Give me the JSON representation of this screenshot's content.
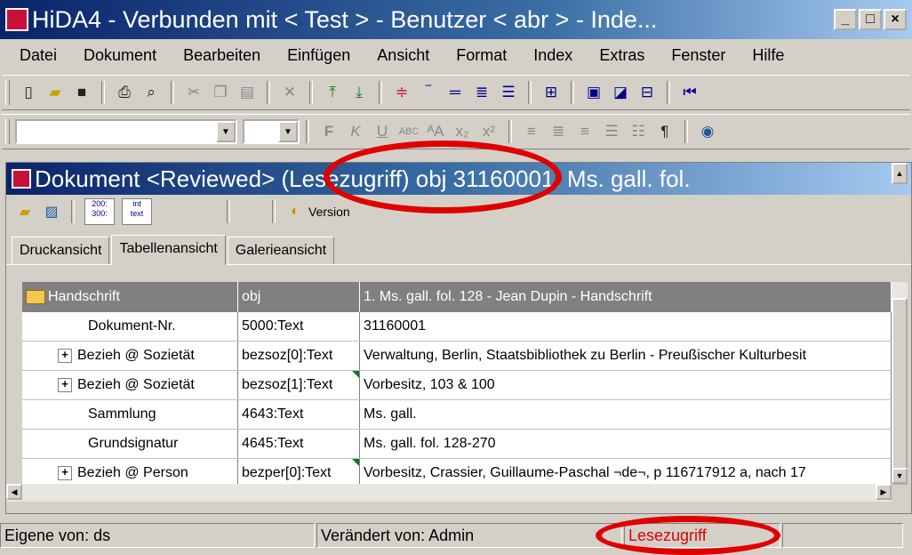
{
  "window": {
    "title": "HiDA4 - Verbunden mit < Test > - Benutzer < abr > - Inde...",
    "controls": [
      "_",
      "□",
      "×"
    ]
  },
  "menu": [
    "Datei",
    "Dokument",
    "Bearbeiten",
    "Einfügen",
    "Ansicht",
    "Format",
    "Index",
    "Extras",
    "Fenster",
    "Hilfe"
  ],
  "document": {
    "title": "Dokument <Reviewed> (Lesezugriff) obj 31160001: Ms. gall. fol.",
    "version_button": "Version",
    "numbers_button": [
      "200:",
      "300:"
    ],
    "inttext_button": [
      "int",
      "text"
    ]
  },
  "tabs": [
    "Druckansicht",
    "Tabellenansicht",
    "Galerieansicht"
  ],
  "active_tab": "Tabellenansicht",
  "table": {
    "header": [
      "Handschrift",
      "obj",
      "1. Ms. gall. fol. 128 - Jean Dupin - Handschrift"
    ],
    "rows": [
      {
        "label": "Dokument-Nr.",
        "field": "5000:Text",
        "value": "31160001",
        "expandable": false,
        "marker": false
      },
      {
        "label": "Bezieh @ Sozietät",
        "field": "bezsoz[0]:Text",
        "value": "Verwaltung, Berlin, Staatsbibliothek zu Berlin - Preußischer Kulturbesit",
        "expandable": true,
        "marker": false
      },
      {
        "label": "Bezieh @ Sozietät",
        "field": "bezsoz[1]:Text",
        "value": "Vorbesitz, 103 & 100",
        "expandable": true,
        "marker": true
      },
      {
        "label": "Sammlung",
        "field": "4643:Text",
        "value": "Ms. gall.",
        "expandable": false,
        "marker": false
      },
      {
        "label": "Grundsignatur",
        "field": "4645:Text",
        "value": "Ms. gall. fol. 128-270",
        "expandable": false,
        "marker": false
      },
      {
        "label": "Bezieh @ Person",
        "field": "bezper[0]:Text",
        "value": "Vorbesitz, Crassier, Guillaume-Paschal ¬de¬, p 116717912 a, nach 17",
        "expandable": true,
        "marker": true
      }
    ]
  },
  "status": {
    "owner": "Eigene von: ds",
    "changed": "Verändert von: Admin",
    "access": "Lesezugriff"
  },
  "colors": {
    "highlight": "#e00000",
    "titlebar": "#0a246a",
    "status_access_text": "#e00000"
  }
}
